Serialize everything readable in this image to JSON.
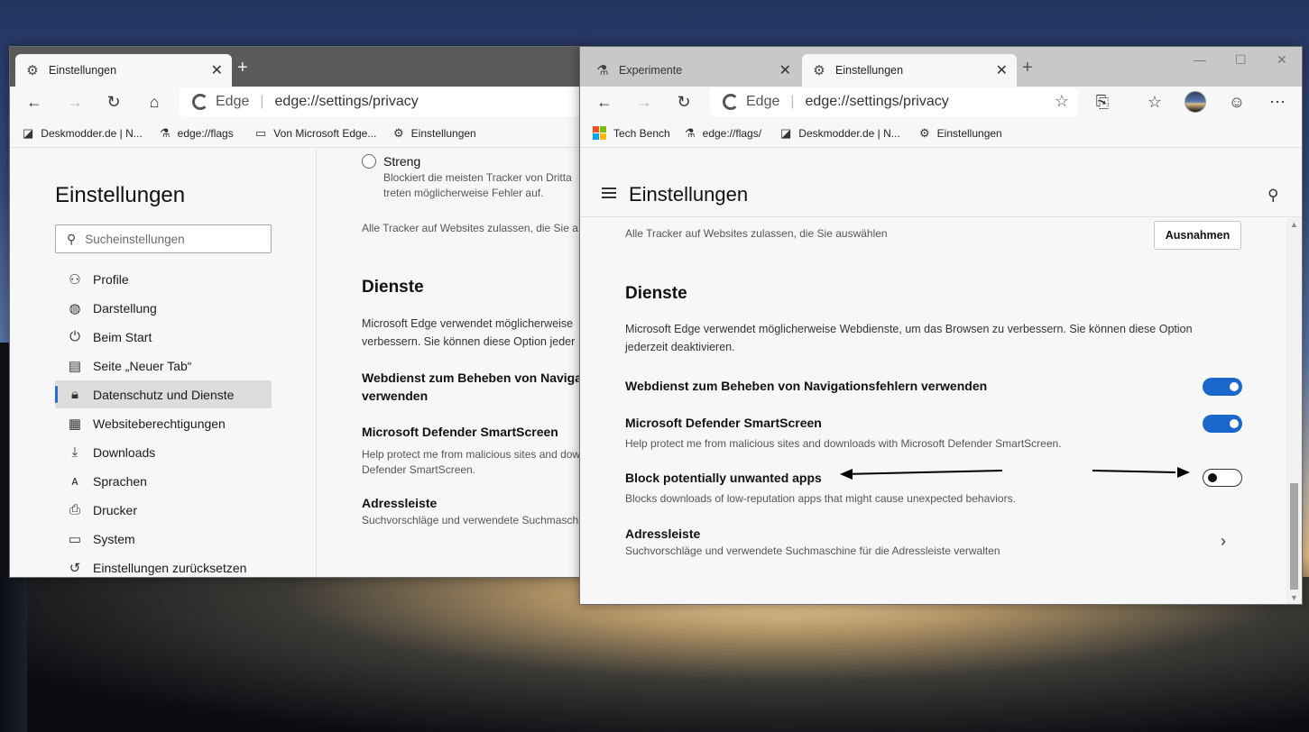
{
  "left_window": {
    "tab": {
      "title": "Einstellungen",
      "close": "✕",
      "icon": "gear-icon"
    },
    "newtab": "+",
    "toolbar": {
      "back": "←",
      "forward": "→",
      "refresh": "↻",
      "home": "⌂"
    },
    "address": {
      "brand": "Edge",
      "separator": "|",
      "url": "edge://settings/privacy"
    },
    "bookmarks": [
      {
        "label": "Deskmodder.de | N...",
        "icon": "deskmodder-icon"
      },
      {
        "label": "edge://flags",
        "icon": "flask-icon"
      },
      {
        "label": "Von Microsoft Edge...",
        "icon": "folder-icon"
      },
      {
        "label": "Einstellungen",
        "icon": "gear-icon"
      }
    ],
    "sidebar": {
      "title": "Einstellungen",
      "search_placeholder": "Sucheinstellungen",
      "items": [
        {
          "label": "Profile",
          "icon": "person-icon"
        },
        {
          "label": "Darstellung",
          "icon": "palette-icon"
        },
        {
          "label": "Beim Start",
          "icon": "power-icon"
        },
        {
          "label": "Seite „Neuer Tab“",
          "icon": "newtab-icon"
        },
        {
          "label": "Datenschutz und Dienste",
          "icon": "lock-icon",
          "selected": true
        },
        {
          "label": "Websiteberechtigungen",
          "icon": "site-permissions-icon"
        },
        {
          "label": "Downloads",
          "icon": "download-icon"
        },
        {
          "label": "Sprachen",
          "icon": "language-icon"
        },
        {
          "label": "Drucker",
          "icon": "printer-icon"
        },
        {
          "label": "System",
          "icon": "laptop-icon"
        },
        {
          "label": "Einstellungen zurücksetzen",
          "icon": "reset-icon"
        }
      ]
    },
    "main": {
      "strict_label": "Streng",
      "strict_desc_1": "Blockiert die meisten Tracker von Dritta",
      "strict_desc_2": "treten möglicherweise Fehler auf.",
      "allow_trackers": "Alle Tracker auf Websites zulassen, die Sie a",
      "dienste_title": "Dienste",
      "dienste_desc_1": "Microsoft Edge verwendet möglicherweise",
      "dienste_desc_2": "verbessern. Sie können diese Option jeder",
      "webdienst_1": "Webdienst zum Beheben von Navigatio",
      "webdienst_2": "verwenden",
      "smartscreen_title": "Microsoft Defender SmartScreen",
      "smartscreen_desc_1": "Help protect me from malicious sites and dow",
      "smartscreen_desc_2": "Defender SmartScreen.",
      "adressleiste_title": "Adressleiste",
      "adressleiste_desc": "Suchvorschläge und verwendete Suchmaschin"
    }
  },
  "right_window": {
    "tabs": [
      {
        "title": "Experimente",
        "close": "✕",
        "icon": "flask-icon",
        "active": false
      },
      {
        "title": "Einstellungen",
        "close": "✕",
        "icon": "gear-icon",
        "active": true
      }
    ],
    "newtab": "+",
    "window_controls": {
      "minimize": "—",
      "maximize": "☐",
      "close": "✕"
    },
    "toolbar": {
      "back": "←",
      "forward": "→",
      "refresh": "↻",
      "favorite_star": "☆",
      "collections": "⎘",
      "favorites": "☆",
      "emoji": "☺",
      "more": "⋯"
    },
    "address": {
      "brand": "Edge",
      "separator": "|",
      "url": "edge://settings/privacy"
    },
    "bookmarks": [
      {
        "label": "Tech Bench",
        "icon": "microsoft-icon"
      },
      {
        "label": "edge://flags/",
        "icon": "flask-icon"
      },
      {
        "label": "Deskmodder.de | N...",
        "icon": "deskmodder-icon"
      },
      {
        "label": "Einstellungen",
        "icon": "gear-icon"
      }
    ],
    "settings": {
      "title": "Einstellungen",
      "allow_trackers": "Alle Tracker auf Websites zulassen, die Sie auswählen",
      "exceptions_button": "Ausnahmen",
      "dienste_title": "Dienste",
      "dienste_desc_1": "Microsoft Edge verwendet möglicherweise Webdienste, um das Browsen zu verbessern. Sie können diese Option",
      "dienste_desc_2": "jederzeit deaktivieren.",
      "webdienst_label": "Webdienst zum Beheben von Navigationsfehlern verwenden",
      "webdienst_on": true,
      "smartscreen_label": "Microsoft Defender SmartScreen",
      "smartscreen_desc": "Help protect me from malicious sites and downloads with Microsoft Defender SmartScreen.",
      "smartscreen_on": true,
      "pua_label": "Block potentially unwanted apps",
      "pua_desc": "Blocks downloads of low-reputation apps that might cause unexpected behaviors.",
      "pua_on": false,
      "adressleiste_label": "Adressleiste",
      "adressleiste_desc": "Suchvorschläge und verwendete Suchmaschine für die Adressleiste verwalten",
      "chevron": "›"
    }
  },
  "colors": {
    "toggle_on": "#1a68cc",
    "selected_bar": "#2a6bd4",
    "annotation_arrow": "#000000"
  }
}
